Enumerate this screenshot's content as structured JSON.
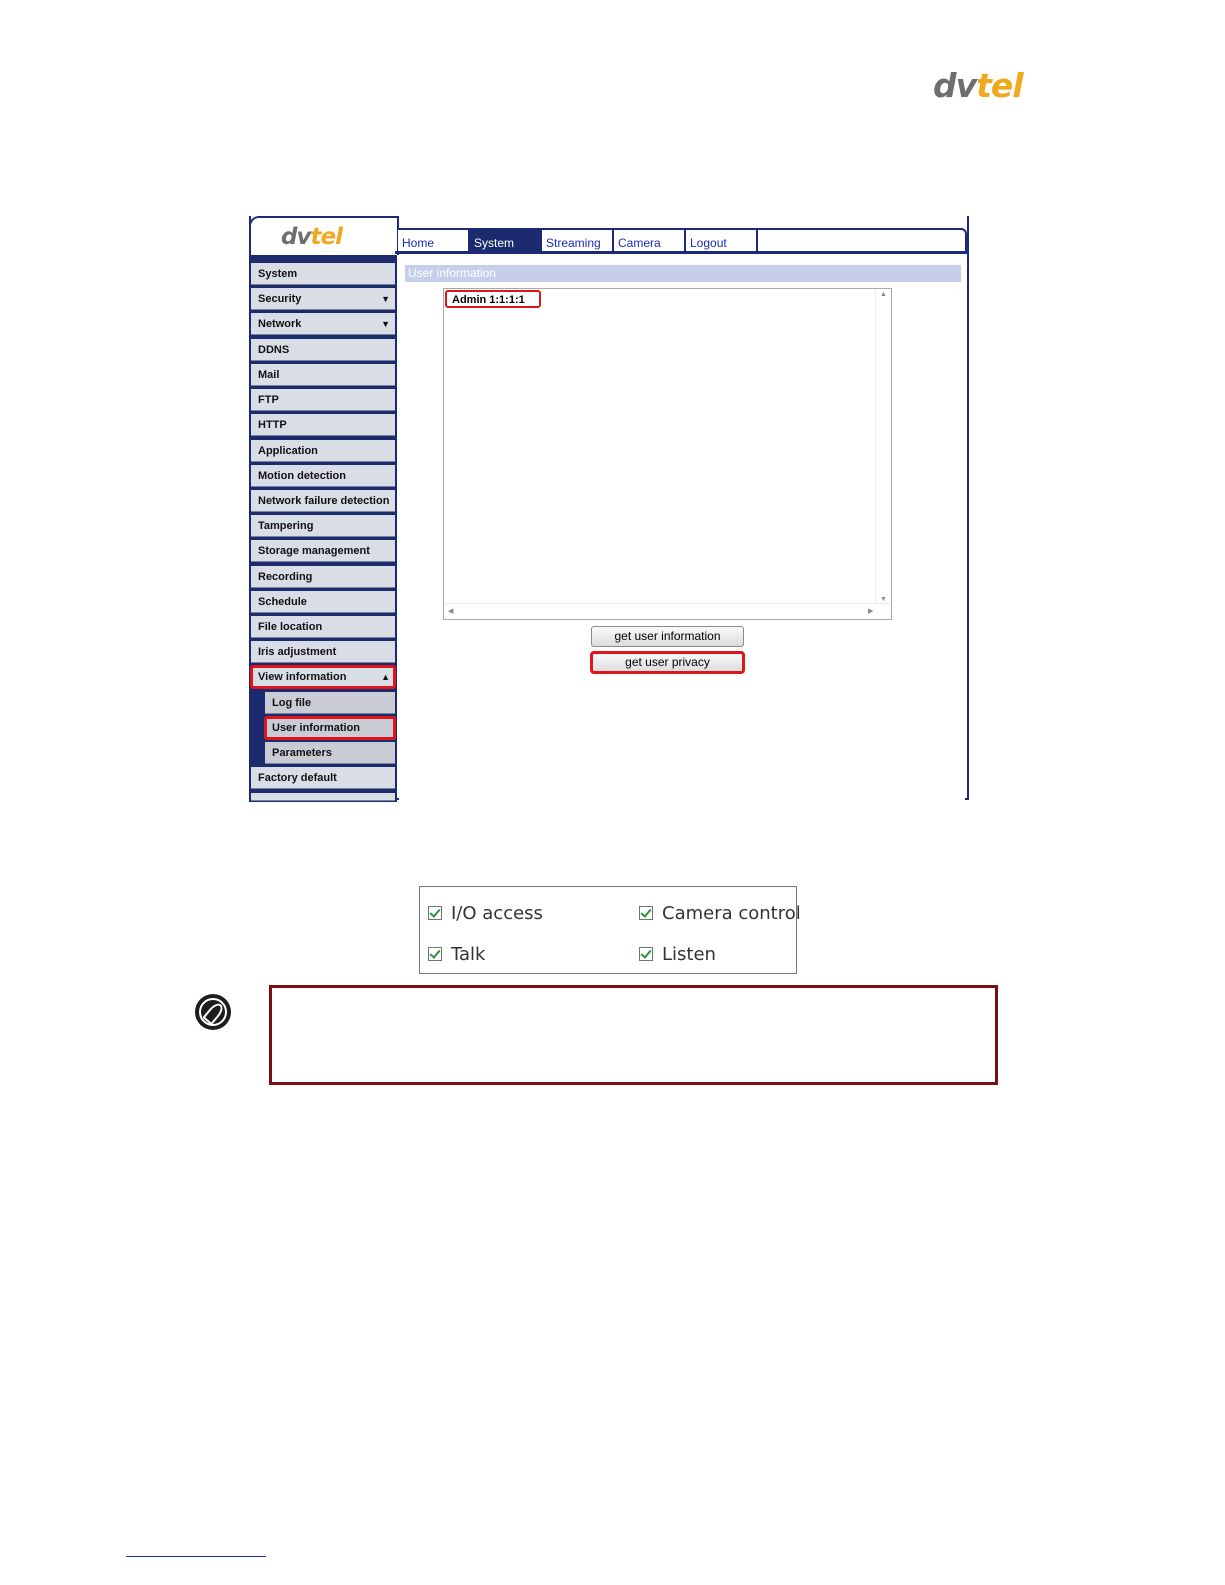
{
  "brand": {
    "dv": "dv",
    "tel": "tel"
  },
  "ui": {
    "logo": {
      "dv": "dv",
      "tel": "tel"
    },
    "nav_tabs": [
      {
        "label": "Home",
        "active": false
      },
      {
        "label": "System",
        "active": true
      },
      {
        "label": "Streaming",
        "active": false
      },
      {
        "label": "Camera",
        "active": false
      },
      {
        "label": "Logout",
        "active": false
      }
    ],
    "sidebar": {
      "items": [
        {
          "label": "System"
        },
        {
          "label": "Security",
          "arrow": "▼"
        },
        {
          "label": "Network",
          "arrow": "▼"
        },
        {
          "label": "DDNS"
        },
        {
          "label": "Mail"
        },
        {
          "label": "FTP"
        },
        {
          "label": "HTTP"
        },
        {
          "label": "Application"
        },
        {
          "label": "Motion detection"
        },
        {
          "label": "Network failure detection"
        },
        {
          "label": "Tampering"
        },
        {
          "label": "Storage management"
        },
        {
          "label": "Recording"
        },
        {
          "label": "Schedule"
        },
        {
          "label": "File location"
        },
        {
          "label": "Iris adjustment"
        },
        {
          "label": "View information",
          "arrow": "▲"
        },
        {
          "label": "Log file"
        },
        {
          "label": "User information"
        },
        {
          "label": "Parameters"
        },
        {
          "label": "Factory default"
        }
      ]
    },
    "content": {
      "section_title": "User information",
      "user_entry": "Admin 1:1:1:1",
      "buttons": {
        "get_user_information": "get user information",
        "get_user_privacy": "get user privacy"
      }
    }
  },
  "permissions": [
    {
      "label": "I/O access",
      "checked": true
    },
    {
      "label": "Camera control",
      "checked": true
    },
    {
      "label": "Talk",
      "checked": true
    },
    {
      "label": "Listen",
      "checked": true
    }
  ],
  "colors": {
    "brand_gray": "#6e6e6e",
    "brand_orange": "#f0a81c",
    "nav_dark": "#1c2a6e",
    "highlight_red": "#e0151b",
    "note_border": "#7b0e12"
  }
}
